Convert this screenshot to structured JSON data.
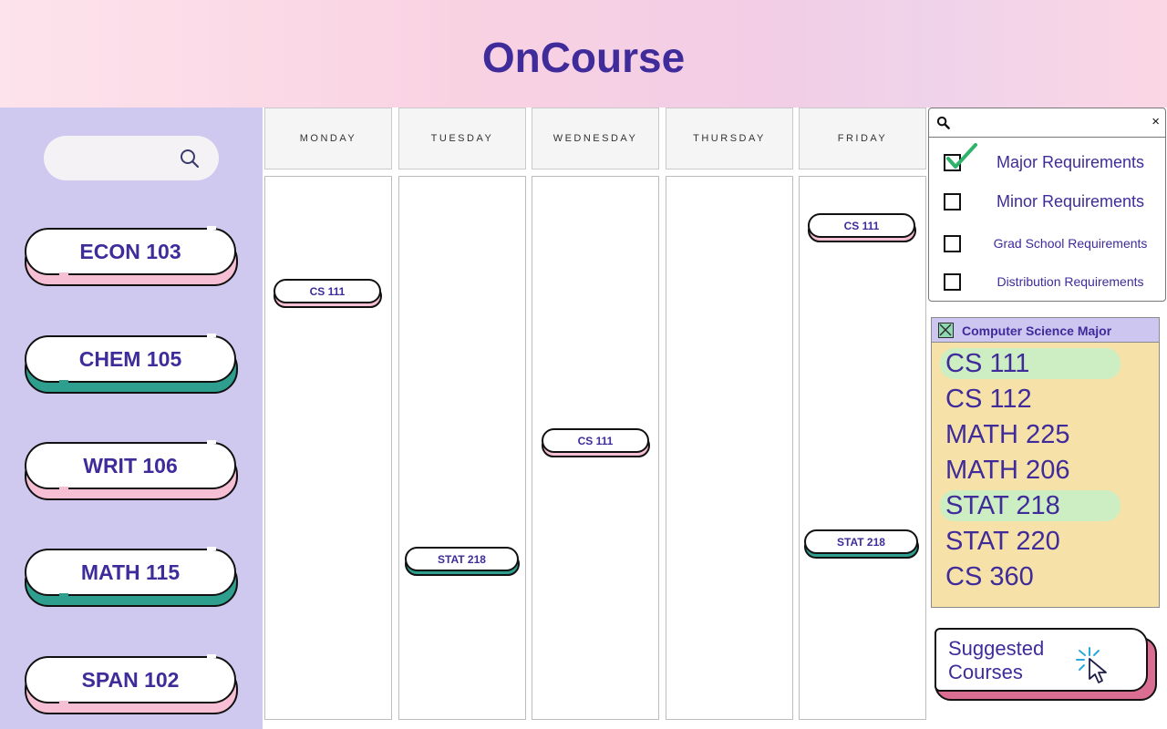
{
  "header": {
    "title": "OnCourse"
  },
  "sidebar": {
    "search": {
      "icon": "search-icon"
    },
    "courses": [
      {
        "label": "ECON 103",
        "accent": "#f6bfd3"
      },
      {
        "label": "CHEM 105",
        "accent": "#2e9e8f"
      },
      {
        "label": "WRIT 106",
        "accent": "#f6bfd3"
      },
      {
        "label": "MATH 115",
        "accent": "#2e9e8f"
      },
      {
        "label": "SPAN 102",
        "accent": "#f6bfd3"
      }
    ]
  },
  "calendar": {
    "days": [
      "MONDAY",
      "TUESDAY",
      "WEDNESDAY",
      "THURSDAY",
      "FRIDAY"
    ],
    "events": [
      {
        "day": "MONDAY",
        "label": "CS 111",
        "accent": "#f6bfd3"
      },
      {
        "day": "TUESDAY",
        "label": "STAT 218",
        "accent": "#2e9e8f"
      },
      {
        "day": "WEDNESDAY",
        "label": "CS 111",
        "accent": "#f6bfd3"
      },
      {
        "day": "FRIDAY",
        "label": "CS 111",
        "accent": "#f6bfd3"
      },
      {
        "day": "FRIDAY",
        "label": "STAT 218",
        "accent": "#2e9e8f"
      }
    ]
  },
  "filters": {
    "search": {
      "icon": "search-icon",
      "clear": "×"
    },
    "options": [
      {
        "label": "Major Requirements",
        "checked": true
      },
      {
        "label": "Minor Requirements",
        "checked": false
      },
      {
        "label": "Grad School Requirements",
        "checked": false
      },
      {
        "label": "Distribution Requirements",
        "checked": false
      }
    ]
  },
  "major": {
    "title": "Computer Science Major",
    "courses": [
      {
        "label": "CS 111",
        "highlighted": true
      },
      {
        "label": "CS 112",
        "highlighted": false
      },
      {
        "label": "MATH 225",
        "highlighted": false
      },
      {
        "label": "MATH 206",
        "highlighted": false
      },
      {
        "label": "STAT 218",
        "highlighted": true
      },
      {
        "label": "STAT 220",
        "highlighted": false
      },
      {
        "label": "CS 360",
        "highlighted": false
      }
    ]
  },
  "suggested": {
    "label": "Suggested Courses",
    "icon": "click-cursor-icon"
  },
  "colors": {
    "brand": "#3f2b9a",
    "sidebar": "#cfc8ef",
    "pink": "#f6bfd3",
    "teal": "#2e9e8f",
    "highlight": "#cdeec3",
    "panel": "#f6e2a8"
  }
}
